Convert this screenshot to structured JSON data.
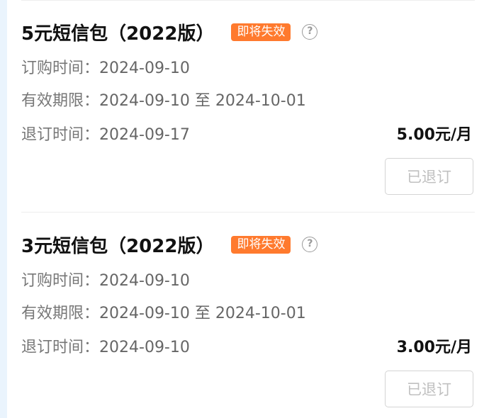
{
  "packages": [
    {
      "title": "5元短信包（2022版）",
      "badge": "即将失效",
      "help_icon": "?",
      "order_label": "订购时间：",
      "order_date": "2024-09-10",
      "validity_label": "有效期限：",
      "validity_value": "2024-09-10 至 2024-10-01",
      "unsub_label": "退订时间：",
      "unsub_date": "2024-09-17",
      "price": "5.00元/月",
      "button_label": "已退订"
    },
    {
      "title": "3元短信包（2022版）",
      "badge": "即将失效",
      "help_icon": "?",
      "order_label": "订购时间：",
      "order_date": "2024-09-10",
      "validity_label": "有效期限：",
      "validity_value": "2024-09-10 至 2024-10-01",
      "unsub_label": "退订时间：",
      "unsub_date": "2024-09-10",
      "price": "3.00元/月",
      "button_label": "已退订"
    }
  ],
  "colors": {
    "badge": "#ff7a2e",
    "background": "#eaf4fd",
    "card": "#ffffff",
    "muted_text": "#6e6e6e",
    "button_text": "#c0c0c0"
  }
}
